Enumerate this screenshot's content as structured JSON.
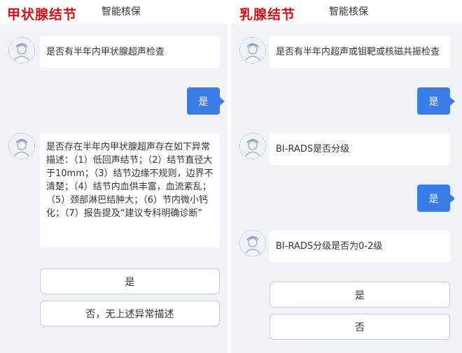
{
  "left_panel": {
    "topic_title": "甲状腺结节",
    "app_title": "智能核保",
    "messages": {
      "q1": "是否有半年内甲状腺超声检查",
      "reply1": "是",
      "q2": "是否存在半年内甲状腺超声存在如下异常描述：（1）低回声结节；（2）结节直径大于10mm；（3）结节边缘不规则，边界不清楚；（4）结节内血供丰富，血流紊乱；（5）颈部淋巴结肿大；（6）节内微小钙化；（7）报告提及“建议专科明确诊断”"
    },
    "options": [
      "是",
      "否，无上述异常描述"
    ]
  },
  "right_panel": {
    "topic_title": "乳腺结节",
    "app_title": "智能核保",
    "messages": {
      "q1": "是否有半年内超声或钼靶或核磁共振检查",
      "reply1": "是",
      "q2": "BI-RADS是否分级",
      "reply2": "是",
      "q3": "BI-RADS分级是否为0-2级"
    },
    "options": [
      "是",
      "否"
    ]
  },
  "colors": {
    "topic_red": "#d0121b",
    "user_bubble_blue": "#3a7ce8",
    "chat_background": "#f2f3f7"
  },
  "icons": {
    "bot_avatar": "nurse-avatar-icon"
  }
}
